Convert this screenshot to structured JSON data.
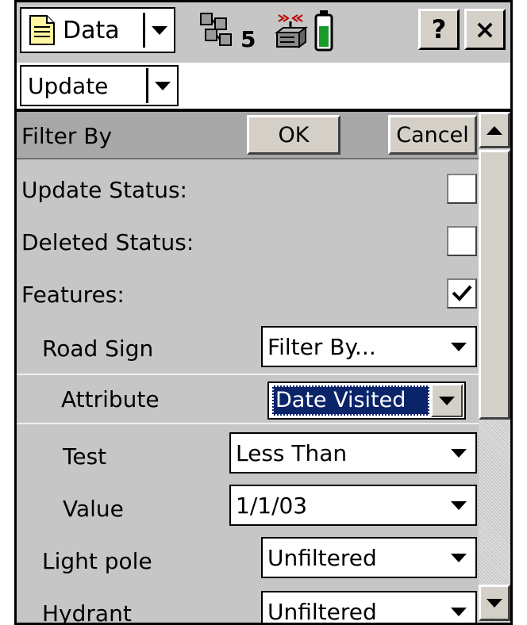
{
  "titlebar": {
    "app_menu_label": "Data",
    "satellite_count": "5",
    "help_label": "?",
    "close_label": "×"
  },
  "updatebar": {
    "mode_label": "Update"
  },
  "form": {
    "header_title": "Filter By",
    "ok_label": "OK",
    "cancel_label": "Cancel",
    "update_status_label": "Update Status:",
    "update_status_checked": false,
    "deleted_status_label": "Deleted Status:",
    "deleted_status_checked": false,
    "features_label": "Features:",
    "features_checked": true,
    "road_sign": {
      "label": "Road Sign",
      "value": "Filter By..."
    },
    "attribute": {
      "label": "Attribute",
      "value": "Date Visited"
    },
    "test": {
      "label": "Test",
      "value": "Less Than"
    },
    "value": {
      "label": "Value",
      "value": "1/1/03"
    },
    "light_pole": {
      "label": "Light pole",
      "value": "Unfiltered"
    },
    "hydrant": {
      "label": "Hydrant",
      "value": "Unfiltered"
    }
  },
  "colors": {
    "selection": "#0a246a",
    "battery": "#1a9a2a",
    "header_bg": "#a8a8a8"
  },
  "icons": [
    "document-icon",
    "satellite-icon",
    "radio-link-icon",
    "battery-icon",
    "help-icon",
    "close-icon"
  ]
}
